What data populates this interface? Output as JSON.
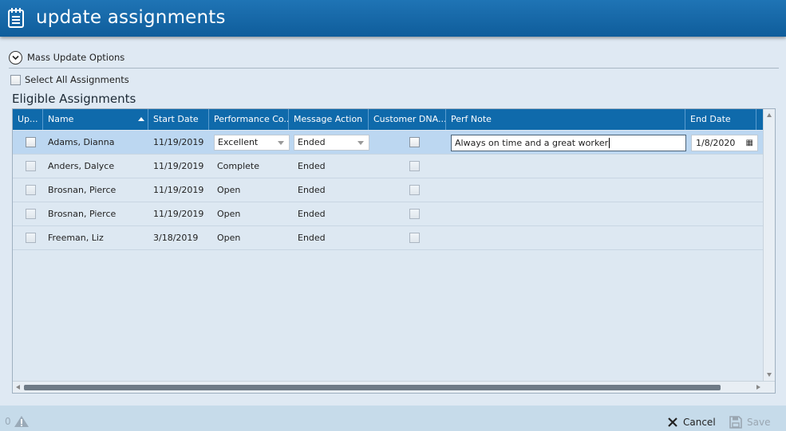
{
  "window": {
    "title": "update assignments",
    "icon": "notepad-icon"
  },
  "mass_update": {
    "label": "Mass Update Options",
    "icon": "chevron-down-circle-icon"
  },
  "select_all": {
    "label": "Select All Assignments",
    "checked": false
  },
  "section_title": "Eligible Assignments",
  "grid": {
    "columns": [
      "Up...",
      "Name",
      "Start Date",
      "Performance Co...",
      "Message Action",
      "Customer DNA...",
      "Perf Note",
      "End Date"
    ],
    "sort_column": "Name",
    "sort_direction": "ascending",
    "rows": [
      {
        "update": false,
        "name": "Adams, Dianna",
        "start_date": "11/19/2019",
        "performance": "Excellent",
        "message_action": "Ended",
        "customer_dna": false,
        "perf_note": "Always on time and a great worker",
        "end_date": "1/8/2020",
        "selected": true,
        "editing": true
      },
      {
        "update": false,
        "name": "Anders, Dalyce",
        "start_date": "11/19/2019",
        "performance": "Complete",
        "message_action": "Ended",
        "customer_dna": false,
        "perf_note": "",
        "end_date": ""
      },
      {
        "update": false,
        "name": "Brosnan, Pierce",
        "start_date": "11/19/2019",
        "performance": "Open",
        "message_action": "Ended",
        "customer_dna": false,
        "perf_note": "",
        "end_date": ""
      },
      {
        "update": false,
        "name": "Brosnan, Pierce",
        "start_date": "11/19/2019",
        "performance": "Open",
        "message_action": "Ended",
        "customer_dna": false,
        "perf_note": "",
        "end_date": ""
      },
      {
        "update": false,
        "name": "Freeman, Liz",
        "start_date": "3/18/2019",
        "performance": "Open",
        "message_action": "Ended",
        "customer_dna": false,
        "perf_note": "",
        "end_date": ""
      }
    ]
  },
  "footer": {
    "warning_count": "0",
    "cancel_label": "Cancel",
    "save_label": "Save",
    "save_enabled": false
  },
  "colors": {
    "titlebar": "#0f6aab",
    "header": "#0f6aab",
    "selected_row": "#bcd7f1",
    "background": "#dfe9f3",
    "footer": "#c6dbea"
  }
}
